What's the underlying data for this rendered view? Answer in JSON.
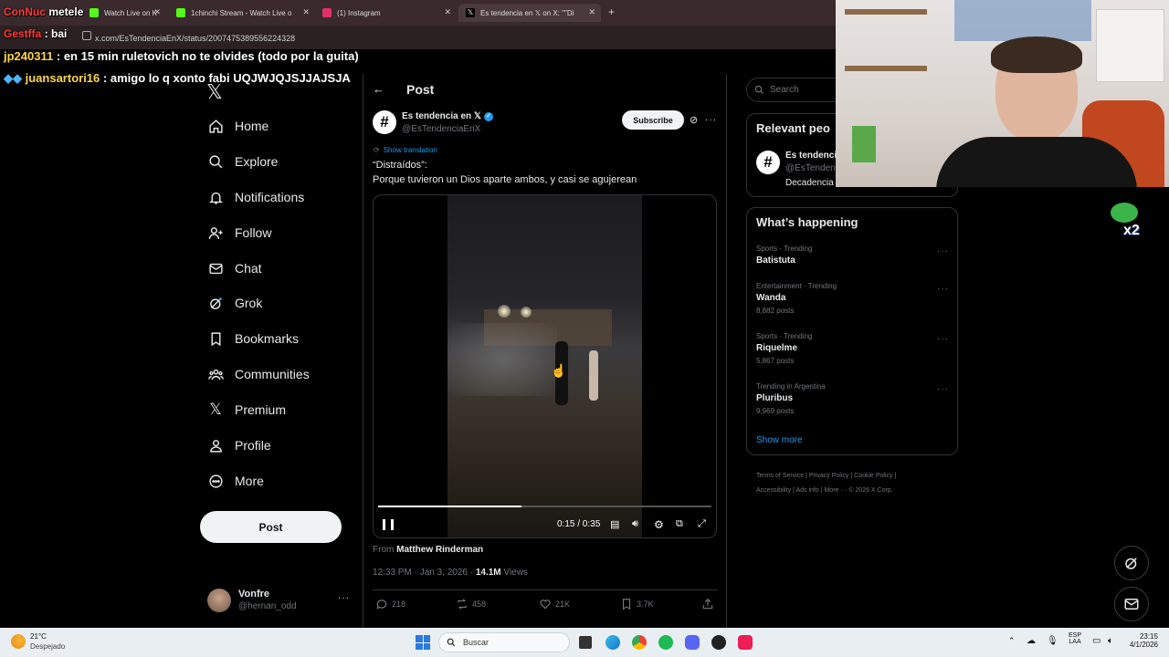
{
  "browser": {
    "tabs": [
      {
        "label": "Watch Live on K",
        "fav_color": "#53fc18"
      },
      {
        "label": "1chinchi Stream - Watch Live o",
        "fav_color": "#53fc18"
      },
      {
        "label": "(1) Instagram",
        "fav_color": "#e1306c"
      },
      {
        "label": "Es tendencia en 𝕏 on X: \"\"Di",
        "fav_color": "#000000"
      }
    ],
    "url": "x.com/EsTendenciaEnX/status/2007475389556224328"
  },
  "chat": [
    {
      "user": "ConNuc",
      "sep": "metele",
      "msg": "",
      "user_color": "#ff3b3b"
    },
    {
      "user": "Gestffa",
      "sep": ":",
      "msg": "bai",
      "user_color": "#ff3b3b"
    },
    {
      "user": "jp240311",
      "sep": ":",
      "msg": "en 15 min ruletovich no te olvides (todo por la guita)",
      "user_color": "#ffd54a"
    },
    {
      "user": "juansartori16",
      "sep": ":",
      "msg": "amigo lo q xonto fabi UQJWJQJSJJAJSJA",
      "user_color": "#ffd54a"
    }
  ],
  "nav": {
    "items": [
      {
        "label": "Home",
        "icon": "home-icon"
      },
      {
        "label": "Explore",
        "icon": "search-icon"
      },
      {
        "label": "Notifications",
        "icon": "bell-icon"
      },
      {
        "label": "Follow",
        "icon": "follow-icon"
      },
      {
        "label": "Chat",
        "icon": "mail-icon"
      },
      {
        "label": "Grok",
        "icon": "grok-icon"
      },
      {
        "label": "Bookmarks",
        "icon": "bookmark-icon"
      },
      {
        "label": "Communities",
        "icon": "communities-icon"
      },
      {
        "label": "Premium",
        "icon": "x-icon"
      },
      {
        "label": "Profile",
        "icon": "profile-icon"
      },
      {
        "label": "More",
        "icon": "more-icon"
      }
    ],
    "post_label": "Post",
    "account": {
      "name": "Vonfre",
      "handle": "@hernan_odd"
    }
  },
  "post": {
    "header_title": "Post",
    "author_name": "Es tendencia en 𝕏",
    "author_handle": "@EsTendenciaEnX",
    "subscribe_label": "Subscribe",
    "show_translation": "Show translation",
    "text_line1": "“Distraídos”:",
    "text_line2": "Porque tuvieron un Dios aparte ambos, y casi se agujerean",
    "video_time": "0:15 / 0:35",
    "video_progress": 0.43,
    "from_label": "From",
    "from_name": "Matthew Rinderman",
    "timestamp": "12:33 PM · Jan 3, 2026 · ",
    "views_count": "14.1M",
    "views_label": "Views",
    "actions": {
      "replies": "218",
      "reposts": "458",
      "likes": "21K",
      "bookmarks": "3.7K"
    }
  },
  "right": {
    "search_placeholder": "Search",
    "relevant_title": "Relevant peo",
    "relevant_name": "Es tendenci",
    "relevant_handle": "@EsTenden",
    "relevant_bio": "Decadencia",
    "happening_title": "What’s happening",
    "trends": [
      {
        "category": "Sports · Trending",
        "name": "Batistuta",
        "count": ""
      },
      {
        "category": "Entertainment · Trending",
        "name": "Wanda",
        "count": "8,882 posts"
      },
      {
        "category": "Sports · Trending",
        "name": "Riquelme",
        "count": "5,867 posts"
      },
      {
        "category": "Trending in Argentina",
        "name": "Pluribus",
        "count": "9,969 posts"
      }
    ],
    "show_more": "Show more",
    "footer": [
      "Terms of Service",
      "Privacy Policy",
      "Cookie Policy",
      "Accessibility",
      "Ads info",
      "More ···",
      "© 2026 X Corp."
    ]
  },
  "taskbar": {
    "weather_temp": "21°C",
    "weather_desc": "Despejado",
    "search_label": "Buscar",
    "lang_top": "ESP",
    "lang_bottom": "LAA",
    "time": "23:15",
    "date": "4/1/2026"
  },
  "colors": {
    "accent": "#1d9bf0",
    "background": "#000000",
    "border": "#2f3336"
  }
}
